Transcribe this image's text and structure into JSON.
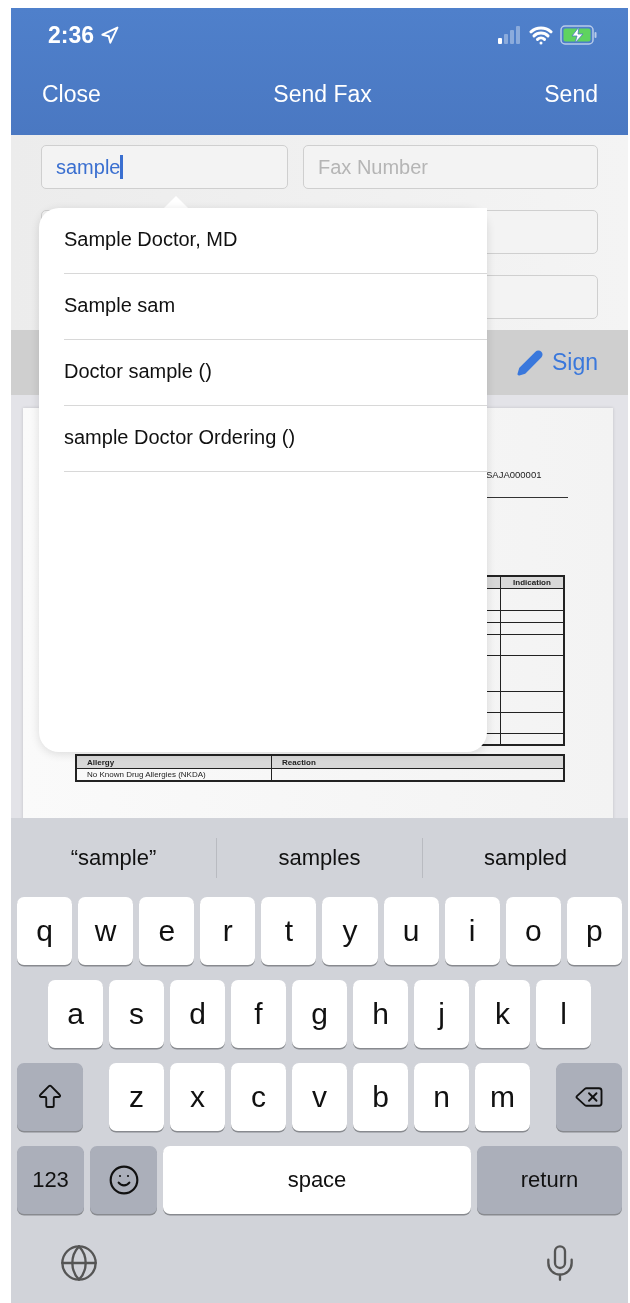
{
  "status_bar": {
    "time": "2:36"
  },
  "nav": {
    "left": "Close",
    "title": "Send Fax",
    "right": "Send"
  },
  "form": {
    "recipient": {
      "value": "sample"
    },
    "fax_number": {
      "placeholder": "Fax Number"
    }
  },
  "toolbar": {
    "sign": "Sign"
  },
  "document": {
    "id": "SAJA000001",
    "medication_table": {
      "columns": [
        "Indication"
      ]
    },
    "allergy_table": {
      "columns": [
        "Allergy",
        "Reaction"
      ],
      "rows": [
        {
          "allergy": "No Known Drug Allergies (NKDA)"
        }
      ]
    }
  },
  "suggestions": [
    "Sample Doctor, MD",
    "Sample sam",
    "Doctor sample ()",
    "sample Doctor Ordering ()"
  ],
  "keyboard": {
    "predictions": [
      "“sample”",
      "samples",
      "sampled"
    ],
    "rows": [
      [
        "q",
        "w",
        "e",
        "r",
        "t",
        "y",
        "u",
        "i",
        "o",
        "p"
      ],
      [
        "a",
        "s",
        "d",
        "f",
        "g",
        "h",
        "j",
        "k",
        "l"
      ],
      [
        "z",
        "x",
        "c",
        "v",
        "b",
        "n",
        "m"
      ]
    ],
    "number_key": "123",
    "space": "space",
    "return": "return"
  }
}
